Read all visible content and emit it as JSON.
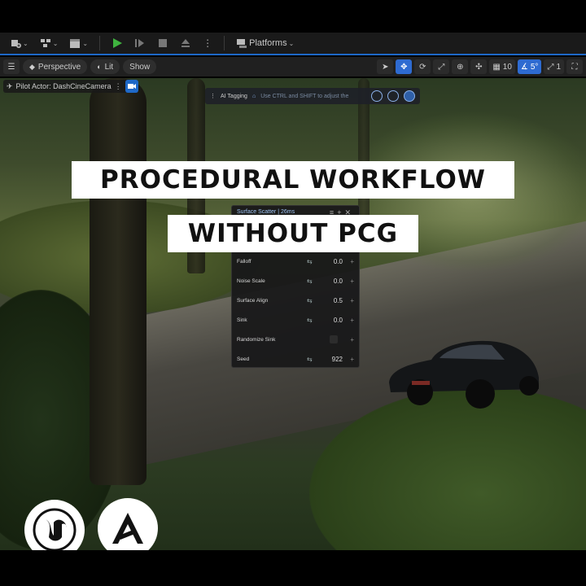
{
  "toolbar": {
    "platforms_label": "Platforms"
  },
  "viewport_bar": {
    "perspective_label": "Perspective",
    "lit_label": "Lit",
    "show_label": "Show",
    "grid_snap_value": "10",
    "angle_snap_value": "5°",
    "speed_value": "1"
  },
  "pilot": {
    "label": "Pilot Actor: DashCineCamera"
  },
  "ai_tagging": {
    "label": "AI Tagging",
    "hint": "Use CTRL and SHIFT to adjust the"
  },
  "headline": {
    "line1": "PROCEDURAL WORKFLOW",
    "line2": "WITHOUT PCG"
  },
  "panel": {
    "title": "Surface Scatter | 26ms",
    "rows": [
      {
        "label": "Falloff",
        "value": "0.0"
      },
      {
        "label": "Noise Scale",
        "value": "0.0"
      },
      {
        "label": "Surface Align",
        "value": "0.5"
      },
      {
        "label": "Sink",
        "value": "0.0"
      },
      {
        "label": "Randomize Sink",
        "value": ""
      },
      {
        "label": "Seed",
        "value": "922"
      }
    ]
  },
  "colors": {
    "accent": "#1e68c7",
    "panel_title": "#9fc4f5"
  },
  "icons": {
    "logo_left": "unreal-engine-logo",
    "logo_right": "a-logo"
  }
}
